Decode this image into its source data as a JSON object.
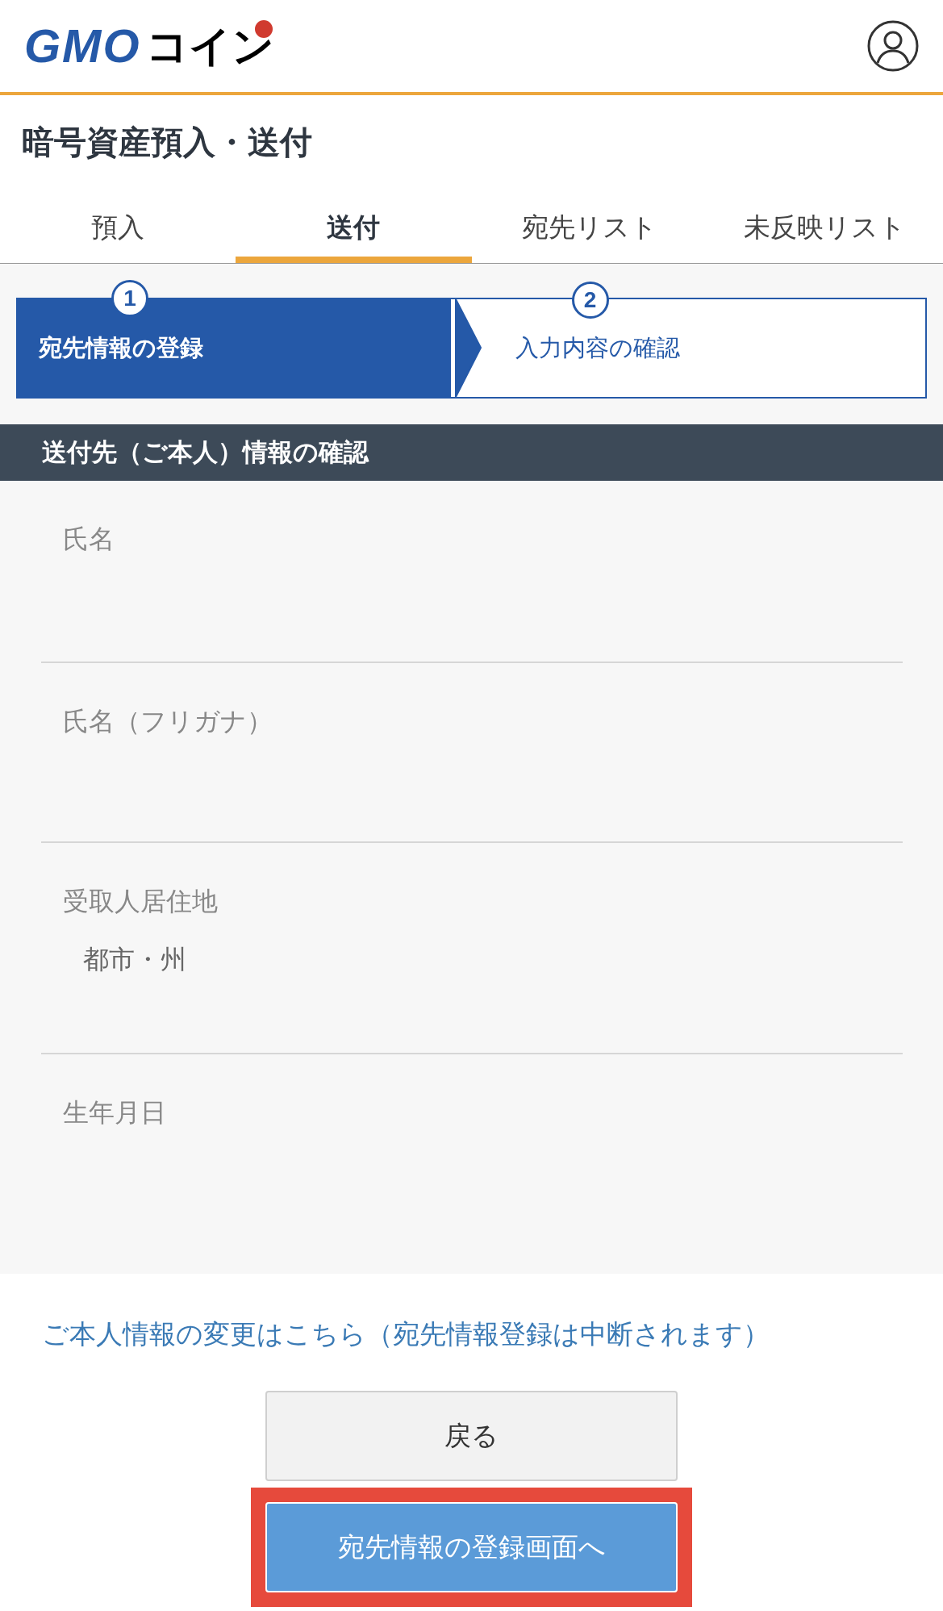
{
  "header": {
    "logo": {
      "latin": "GMO",
      "kana": "コイン"
    }
  },
  "page_title": "暗号資産預入・送付",
  "tabs": [
    {
      "label": "預入",
      "selected": false
    },
    {
      "label": "送付",
      "selected": true
    },
    {
      "label": "宛先リスト",
      "selected": false
    },
    {
      "label": "未反映リスト",
      "selected": false
    }
  ],
  "steps": [
    {
      "number": "1",
      "label": "宛先情報の登録",
      "selected": true
    },
    {
      "number": "2",
      "label": "入力内容の確認",
      "selected": false
    }
  ],
  "section_title": "送付先（ご本人）情報の確認",
  "fields": [
    {
      "label": "氏名"
    },
    {
      "label": "氏名（フリガナ）"
    },
    {
      "label": "受取人居住地",
      "value": "都市・州"
    },
    {
      "label": "生年月日"
    }
  ],
  "change_link": "ご本人情報の変更はこちら（宛先情報登録は中断されます）",
  "buttons": [
    {
      "kind": "secondary",
      "label": "戻る",
      "highlighted": false
    },
    {
      "kind": "primary",
      "label": "宛先情報の登録画面へ",
      "highlighted": true
    }
  ]
}
